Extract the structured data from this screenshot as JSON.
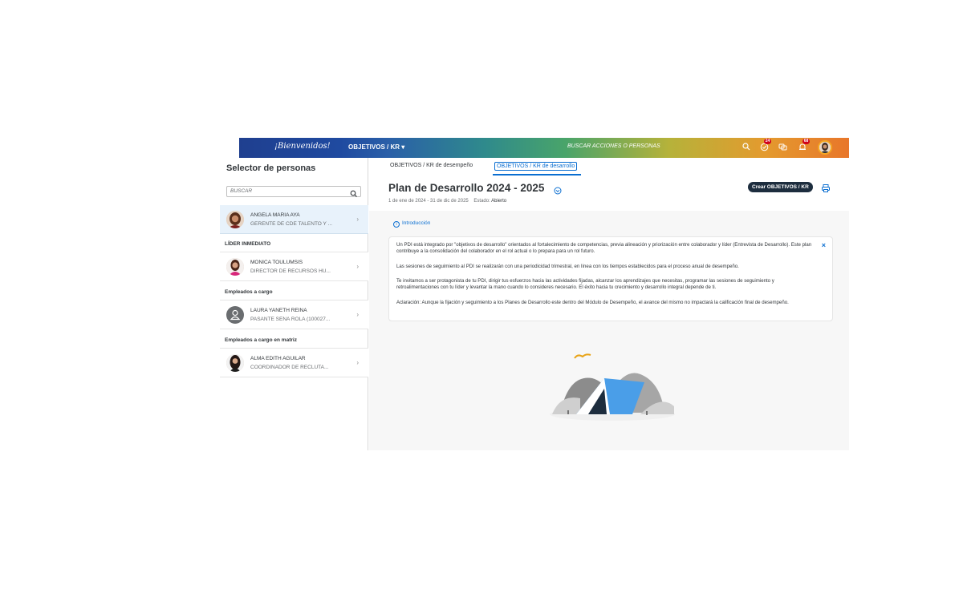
{
  "topbar": {
    "logo_text": "¡Bienvenidos!",
    "nav_title": "OBJETIVOS / KR ▾",
    "search_text": "BUSCAR ACCIONES O PERSONAS",
    "badges": {
      "approvals": "24",
      "notifications": "68"
    },
    "icons": [
      "search-icon",
      "approvals-icon",
      "chat-icon",
      "notifications-icon",
      "user-avatar"
    ]
  },
  "left": {
    "title": "Selector de personas",
    "search_placeholder": "BUSCAR",
    "selected_person": {
      "name": "ANGELA MARIA AYA",
      "role": "GERENTE DE CDE TALENTO Y ..."
    },
    "sections": [
      {
        "label": "LÍDER INMEDIATO",
        "people": [
          {
            "name": "MONICA TOULUMSIS",
            "role": "DIRECTOR DE RECURSOS HU..."
          }
        ]
      },
      {
        "label": "Empleados a cargo",
        "people": [
          {
            "name": "LAURA YANETH REINA",
            "role": "PASANTE SENA ROLA (100027..."
          }
        ]
      },
      {
        "label": "Empleados a cargo en matriz",
        "people": [
          {
            "name": "ALMA EDITH AGUILAR",
            "role": "COORDINADOR DE RECLUTA..."
          }
        ]
      }
    ]
  },
  "main": {
    "tabs": [
      {
        "label": "OBJETIVOS / KR de desempeño",
        "active": false
      },
      {
        "label": "OBJETIVOS / KR de desarrollo",
        "active": true
      }
    ],
    "page_title": "Plan de Desarrollo 2024 - 2025",
    "date_range": "1 de ene de 2024 - 31 de dic de 2025",
    "status_label": "Estado:",
    "status_value": "Abierto",
    "create_button": "Crear OBJETIVOS / KR",
    "intro_link": "Introducción",
    "intro_paragraphs": [
      "Un PDI está integrado por \"objetivos de desarrollo\" orientados al fortalecimiento de competencias, previa alineación y priorización entre colaborador y líder (Entrevista de Desarrollo). Este plan contribuye a la consolidación del colaborador en el rol actual o lo prepara para un rol futuro.",
      "Las sesiones de seguimiento al PDI se realizarán con una periodicidad trimestral, en línea con los tiempos establecidos para el proceso anual de desempeño.",
      "Te invitamos a ser protagonista de tu PDI, dirigir tus esfuerzos hacia las actividades fijadas, alcanzar los aprendizajes que necesitas, programar las sesiones de seguimiento y retroalimentaciones con tu líder y levantar la mano cuando lo consideres necesario. El éxito hacia tu crecimiento y desarrollo integral depende de ti.",
      "Aclaración: Aunque la fijación y seguimiento a los Planes de Desarrollo este dentro del Módulo de Desempeño, el avance del mismo no impactará la calificación final de desempeño."
    ]
  },
  "colors": {
    "accent": "#0a6ed1",
    "dark_button": "#1d2d3e",
    "badge": "#d0021b"
  }
}
